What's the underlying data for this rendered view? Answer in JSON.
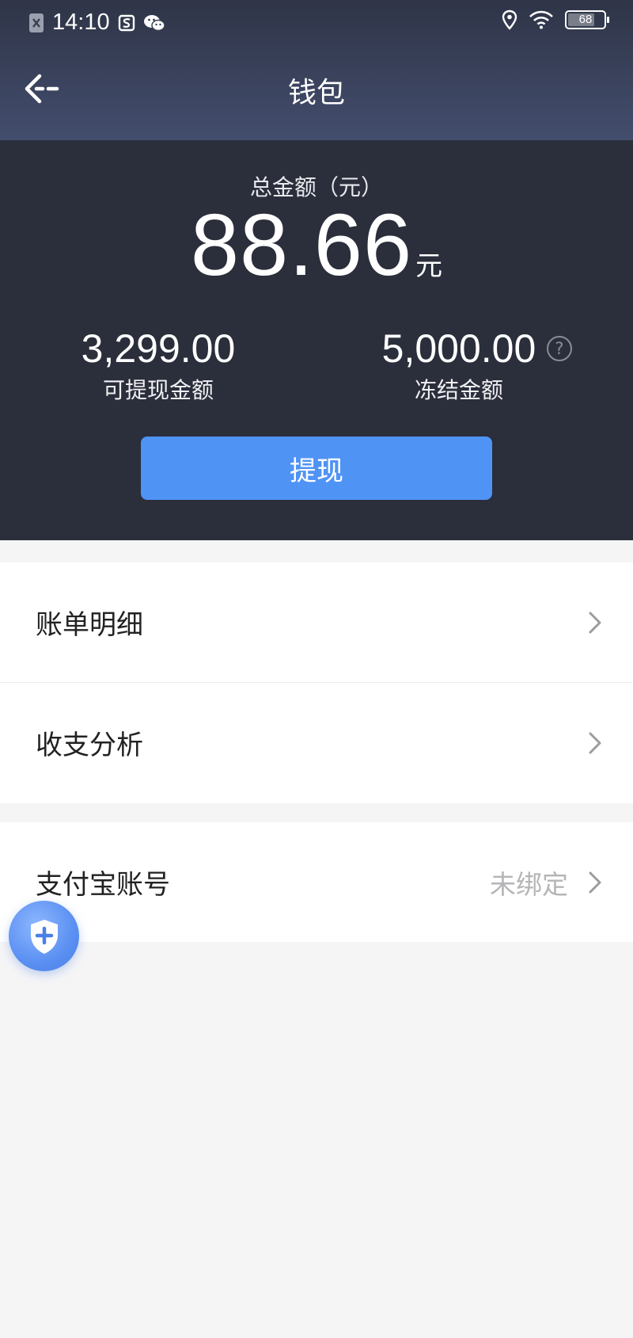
{
  "status_bar": {
    "time": "14:10",
    "battery": "68",
    "icons": [
      "notification-x-icon",
      "s-app-icon",
      "wechat-icon",
      "location-icon",
      "wifi-icon",
      "battery-icon"
    ]
  },
  "header": {
    "title": "钱包",
    "back_icon": "back-arrow-icon"
  },
  "summary": {
    "total_label": "总金额（元）",
    "total_value": "88.66",
    "total_unit": "元",
    "withdrawable_value": "3,299.00",
    "withdrawable_label": "可提现金额",
    "frozen_value": "5,000.00",
    "frozen_label": "冻结金额",
    "help_icon_text": "?",
    "withdraw_button": "提现"
  },
  "menu": {
    "bill_details": "账单明细",
    "income_analysis": "收支分析",
    "alipay_account": "支付宝账号",
    "alipay_status": "未绑定"
  },
  "fab": {
    "icon": "shield-plus-icon"
  },
  "colors": {
    "header_gradient_top": "#2f3547",
    "header_gradient_bottom": "#434d6d",
    "summary_bg": "#2b2e3b",
    "primary_button": "#4f93f5",
    "page_bg": "#f5f5f6"
  }
}
